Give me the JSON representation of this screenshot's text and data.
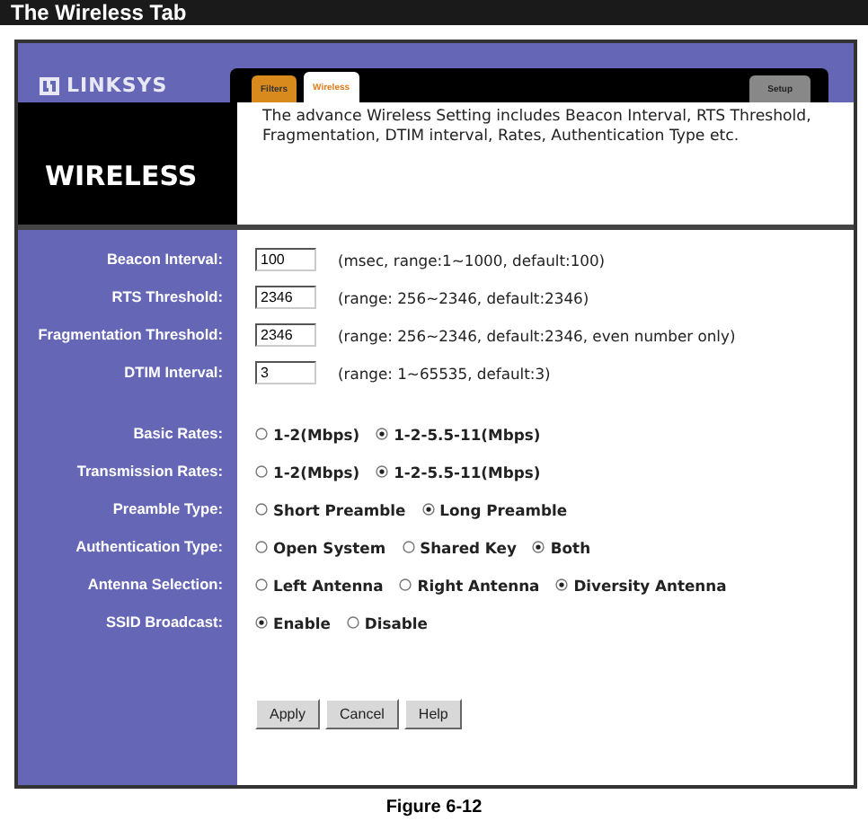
{
  "page_heading": "The Wireless Tab",
  "logo": {
    "text": "LINKSYS"
  },
  "tabs": [
    {
      "label": "Filters",
      "selected": false
    },
    {
      "label": "Wireless",
      "selected": true
    },
    {
      "label": "Setup",
      "selected": false
    }
  ],
  "section_title": "WIRELESS",
  "description": "The advance Wireless Setting includes Beacon Interval, RTS Threshold, Fragmentation, DTIM interval, Rates, Authentication Type etc.",
  "fields": [
    {
      "kind": "text",
      "label": "Beacon Interval:",
      "value": "100",
      "hint": "(msec, range:1~1000, default:100)"
    },
    {
      "kind": "text",
      "label": "RTS Threshold:",
      "value": "2346",
      "hint": "(range: 256~2346, default:2346)"
    },
    {
      "kind": "text",
      "label": "Fragmentation Threshold:",
      "value": "2346",
      "hint": "(range: 256~2346, default:2346, even number only)"
    },
    {
      "kind": "text",
      "label": "DTIM Interval:",
      "value": "3",
      "hint": "(range: 1~65535, default:3)"
    },
    {
      "kind": "radio",
      "label": "Basic Rates:",
      "options": [
        {
          "label": "1-2(Mbps)",
          "selected": false
        },
        {
          "label": "1-2-5.5-11(Mbps)",
          "selected": true
        }
      ]
    },
    {
      "kind": "radio",
      "label": "Transmission Rates:",
      "options": [
        {
          "label": "1-2(Mbps)",
          "selected": false
        },
        {
          "label": "1-2-5.5-11(Mbps)",
          "selected": true
        }
      ]
    },
    {
      "kind": "radio",
      "label": "Preamble Type:",
      "options": [
        {
          "label": "Short Preamble",
          "selected": false
        },
        {
          "label": "Long Preamble",
          "selected": true
        }
      ]
    },
    {
      "kind": "radio",
      "label": "Authentication Type:",
      "options": [
        {
          "label": "Open System",
          "selected": false
        },
        {
          "label": "Shared Key",
          "selected": false
        },
        {
          "label": "Both",
          "selected": true
        }
      ]
    },
    {
      "kind": "radio",
      "label": "Antenna Selection:",
      "options": [
        {
          "label": "Left Antenna",
          "selected": false
        },
        {
          "label": "Right Antenna",
          "selected": false
        },
        {
          "label": "Diversity Antenna",
          "selected": true
        }
      ]
    },
    {
      "kind": "radio",
      "label": "SSID Broadcast:",
      "options": [
        {
          "label": "Enable",
          "selected": true
        },
        {
          "label": "Disable",
          "selected": false
        }
      ]
    }
  ],
  "buttons": [
    "Apply",
    "Cancel",
    "Help"
  ],
  "caption": "Figure 6-12"
}
